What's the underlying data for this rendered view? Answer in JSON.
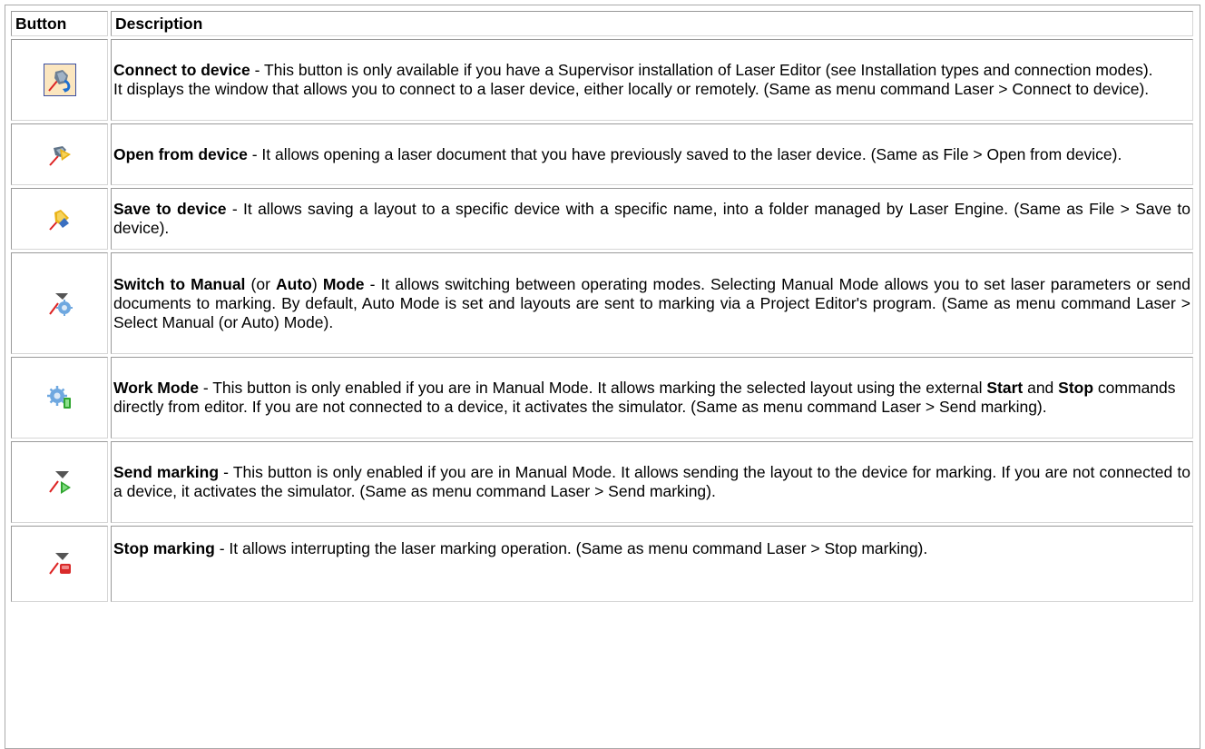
{
  "header": {
    "col_button": "Button",
    "col_description": "Description"
  },
  "rows": [
    {
      "icon": "connect-to-device-icon",
      "title": "Connect to device",
      "text1": " - This button is only available if you have a Supervisor installation of Laser Editor (see Installation types and connection modes).",
      "text2": "It displays the window that allows you to connect to a laser device, either locally or remotely. (Same as menu command Laser > Connect to device)."
    },
    {
      "icon": "open-from-device-icon",
      "title": "Open from device",
      "text1": " - It allows opening a laser document that you have previously saved to the laser device. (Same as File > Open from device)."
    },
    {
      "icon": "save-to-device-icon",
      "title": "Save to device",
      "text1": " - It allows saving a layout to a specific device with a specific name, into a folder managed by Laser Engine. (Same as File > Save to device)."
    },
    {
      "icon": "switch-mode-icon",
      "title": "Switch to Manual",
      "mid1": " (or ",
      "mid_bold": "Auto",
      "mid2": ") ",
      "title2": "Mode",
      "text1": " - It allows switching between operating modes. Selecting Manual Mode allows you to set laser parameters or send documents to marking. By default, Auto Mode is set and layouts are sent to marking via a Project Editor's program. (Same as menu command Laser > Select Manual (or Auto) Mode)."
    },
    {
      "icon": "work-mode-icon",
      "title": "Work Mode",
      "text1": " - This button is only enabled if you are in Manual Mode. It allows marking the selected layout using the external ",
      "bold_start": "Start",
      "and": " and ",
      "bold_stop": "Stop",
      "text2": " commands directly from editor. If you are not connected to a device, it activates the simulator. (Same as menu command Laser > Send marking)."
    },
    {
      "icon": "send-marking-icon",
      "title": "Send marking",
      "text1": " - This button is only enabled if you are in Manual Mode. It allows sending the layout to the device for marking. If you are not connected to a device, it activates the simulator. (Same as menu command Laser > Send marking)."
    },
    {
      "icon": "stop-marking-icon",
      "title": "Stop marking",
      "text1": " - It allows interrupting the laser marking operation. (Same as menu command Laser > Stop marking)."
    }
  ]
}
